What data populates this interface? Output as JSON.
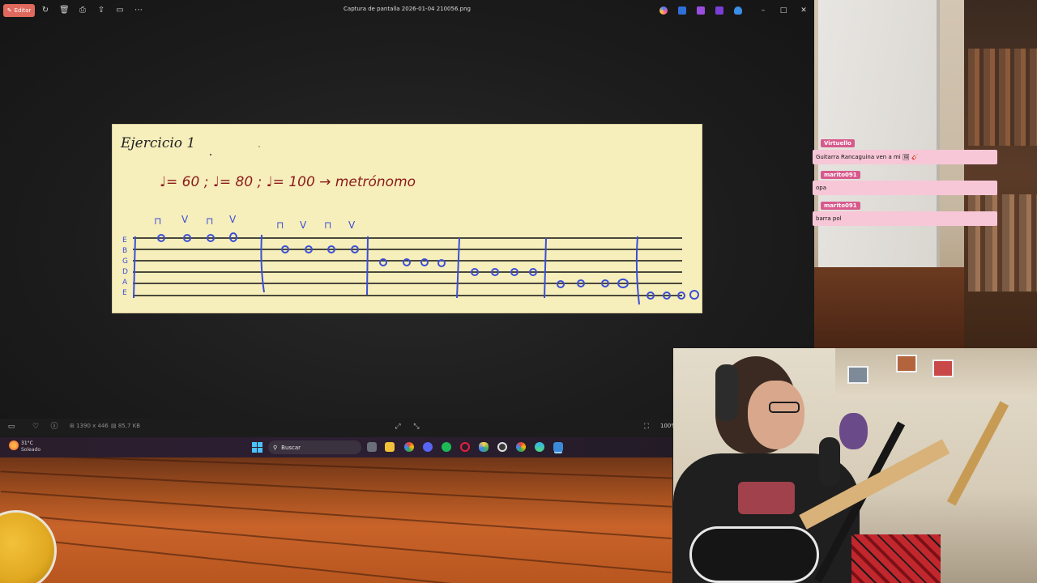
{
  "viewer": {
    "edit_label": "Editar",
    "title": "Captura de pantalla 2026-01-04 210056.png",
    "status": {
      "dimensions": "1390 x 446",
      "filesize": "85,7 KB",
      "zoom": "100%"
    }
  },
  "score": {
    "heading": "Ejercicio 1",
    "tempo_text": "♩= 60 ; ♩= 80 ; ♩= 100 → metrónomo",
    "strings": [
      "E",
      "B",
      "G",
      "D",
      "A",
      "E"
    ],
    "picking_1": [
      "⊓",
      "V",
      "⊓",
      "V"
    ],
    "picking_2": [
      "⊓",
      "V",
      "⊓",
      "V"
    ]
  },
  "taskbar": {
    "temperature": "31°C",
    "weather": "Soleado",
    "search_label": "Buscar"
  },
  "chat": [
    {
      "user": "Virtuello",
      "message": "Guitarra Rancaguina ven a mi 🖼 🎸"
    },
    {
      "user": "marito091",
      "message": "opa"
    },
    {
      "user": "marito091",
      "message": "barra pol"
    }
  ],
  "colors": {
    "accent": "#e0685c",
    "paper": "#f6eebb",
    "ink_red": "#8c1a1a",
    "ink_blue": "#3b4fd6",
    "chat_name_bg": "#d85a8c",
    "chat_msg_bg": "#f7c7d8"
  }
}
